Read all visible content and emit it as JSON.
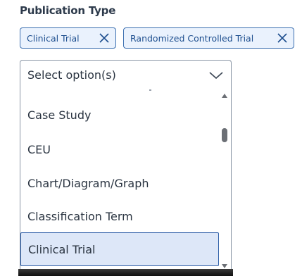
{
  "field": {
    "label": "Publication Type"
  },
  "selected_tags": [
    {
      "label": "Clinical Trial",
      "remove_icon": "close-icon"
    },
    {
      "label": "Randomized Controlled Trial",
      "remove_icon": "close-icon"
    }
  ],
  "select": {
    "placeholder": "Select option(s)",
    "toggle_icon": "chevron-down-icon"
  },
  "options": [
    {
      "label": "Case Study",
      "selected": false
    },
    {
      "label": "CEU",
      "selected": false
    },
    {
      "label": "Chart/Diagram/Graph",
      "selected": false
    },
    {
      "label": "Classification Term",
      "selected": false
    },
    {
      "label": "Clinical Trial",
      "selected": true
    }
  ],
  "colors": {
    "tag_border": "#3b6fb0",
    "tag_background": "#eaf2fd",
    "selected_option_background": "#dde7f8",
    "selected_option_border": "#2f5fa8"
  }
}
